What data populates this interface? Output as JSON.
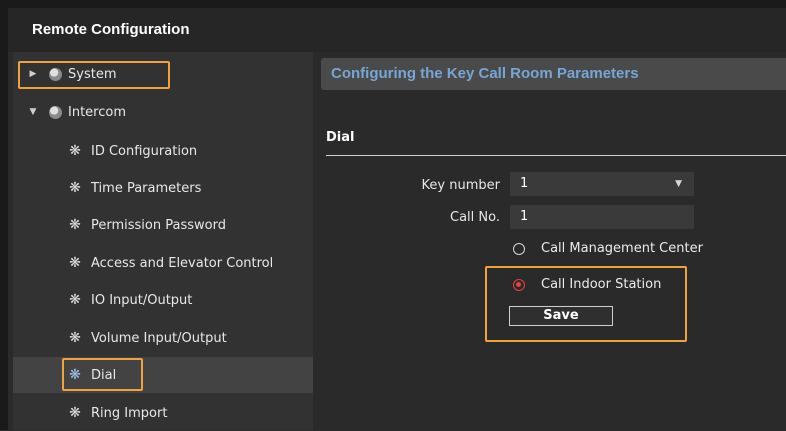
{
  "window": {
    "title": "Remote Configuration"
  },
  "sidebar": {
    "items": [
      {
        "label": "System",
        "level": 0,
        "expanded": false,
        "icon": "globe-icon",
        "highlighted": true
      },
      {
        "label": "Intercom",
        "level": 0,
        "expanded": true,
        "icon": "globe-icon",
        "highlighted": false
      },
      {
        "label": "ID Configuration",
        "level": 1,
        "icon": "gear-icon"
      },
      {
        "label": "Time Parameters",
        "level": 1,
        "icon": "gear-icon"
      },
      {
        "label": "Permission Password",
        "level": 1,
        "icon": "gear-icon"
      },
      {
        "label": "Access and Elevator Control",
        "level": 1,
        "icon": "gear-icon"
      },
      {
        "label": "IO Input/Output",
        "level": 1,
        "icon": "gear-icon"
      },
      {
        "label": "Volume Input/Output",
        "level": 1,
        "icon": "gear-icon"
      },
      {
        "label": "Dial",
        "level": 1,
        "icon": "gear-icon",
        "selected": true,
        "highlighted": true
      },
      {
        "label": "Ring Import",
        "level": 1,
        "icon": "gear-icon"
      }
    ]
  },
  "content": {
    "header": "Configuring the Key Call Room Parameters",
    "section_title": "Dial",
    "key_number": {
      "label": "Key number",
      "value": "1"
    },
    "call_no": {
      "label": "Call No.",
      "value": "1"
    },
    "radio_options": [
      {
        "label": "Call Management Center",
        "selected": false
      },
      {
        "label": "Call Indoor Station",
        "selected": true
      }
    ],
    "save_label": "Save"
  },
  "colors": {
    "highlight_border": "#f2a23c",
    "header_text": "#76a6d6",
    "radio_selected": "#e94040"
  }
}
